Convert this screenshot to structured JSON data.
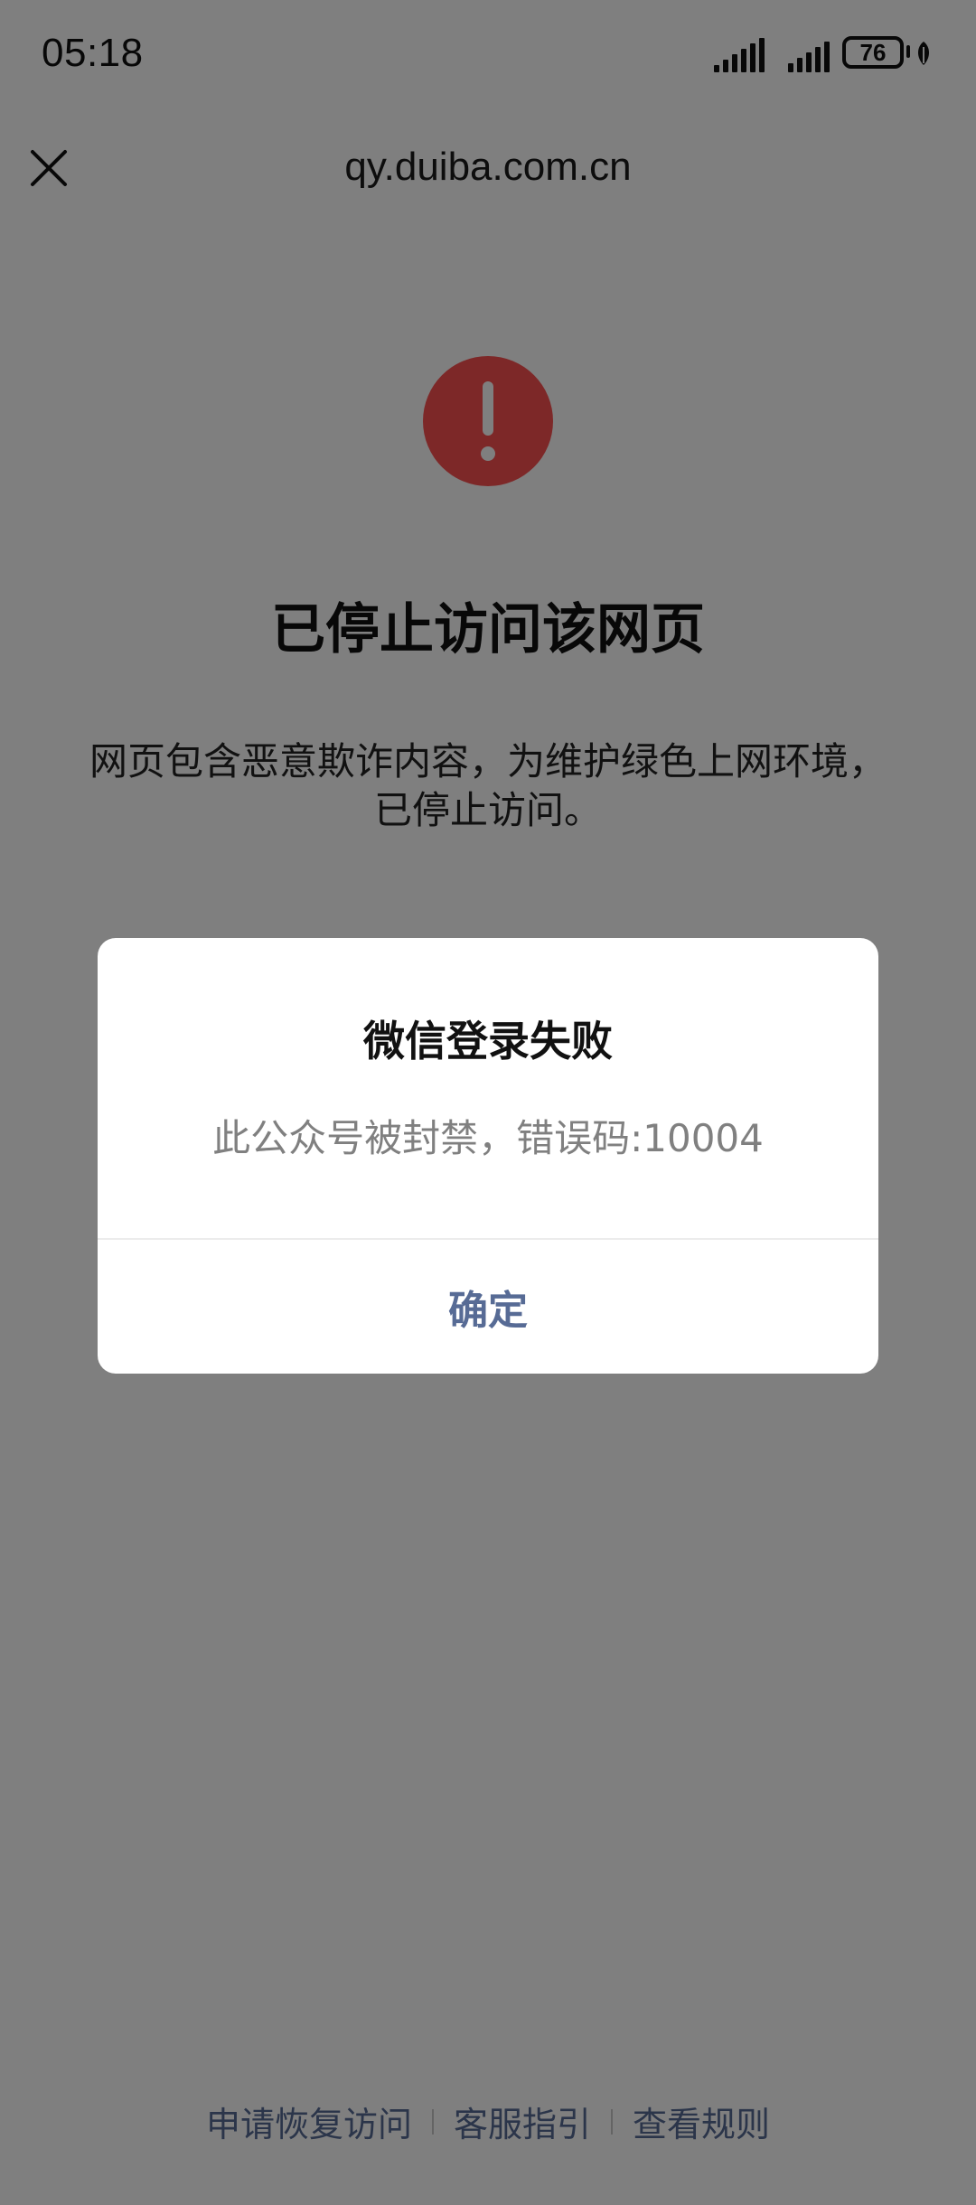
{
  "status_bar": {
    "time": "05:18",
    "battery_level": "76",
    "icons": [
      "signal-hd-icon",
      "signal-icon",
      "battery-icon",
      "leaf-icon"
    ]
  },
  "navbar": {
    "close_icon": "close-icon",
    "url": "qy.duiba.com.cn"
  },
  "blocked_page": {
    "icon": "warning-icon",
    "icon_color": "#fa5151",
    "title": "已停止访问该网页",
    "description": "网页包含恶意欺诈内容，为维护绿色上网环境，已停止访问。"
  },
  "dialog": {
    "title": "微信登录失败",
    "message": "此公众号被封禁，错误码:10004",
    "confirm_label": "确定",
    "accent_color": "#576b95"
  },
  "footer": {
    "links": [
      "申请恢复访问",
      "客服指引",
      "查看规则"
    ],
    "link_color": "#576b95"
  }
}
